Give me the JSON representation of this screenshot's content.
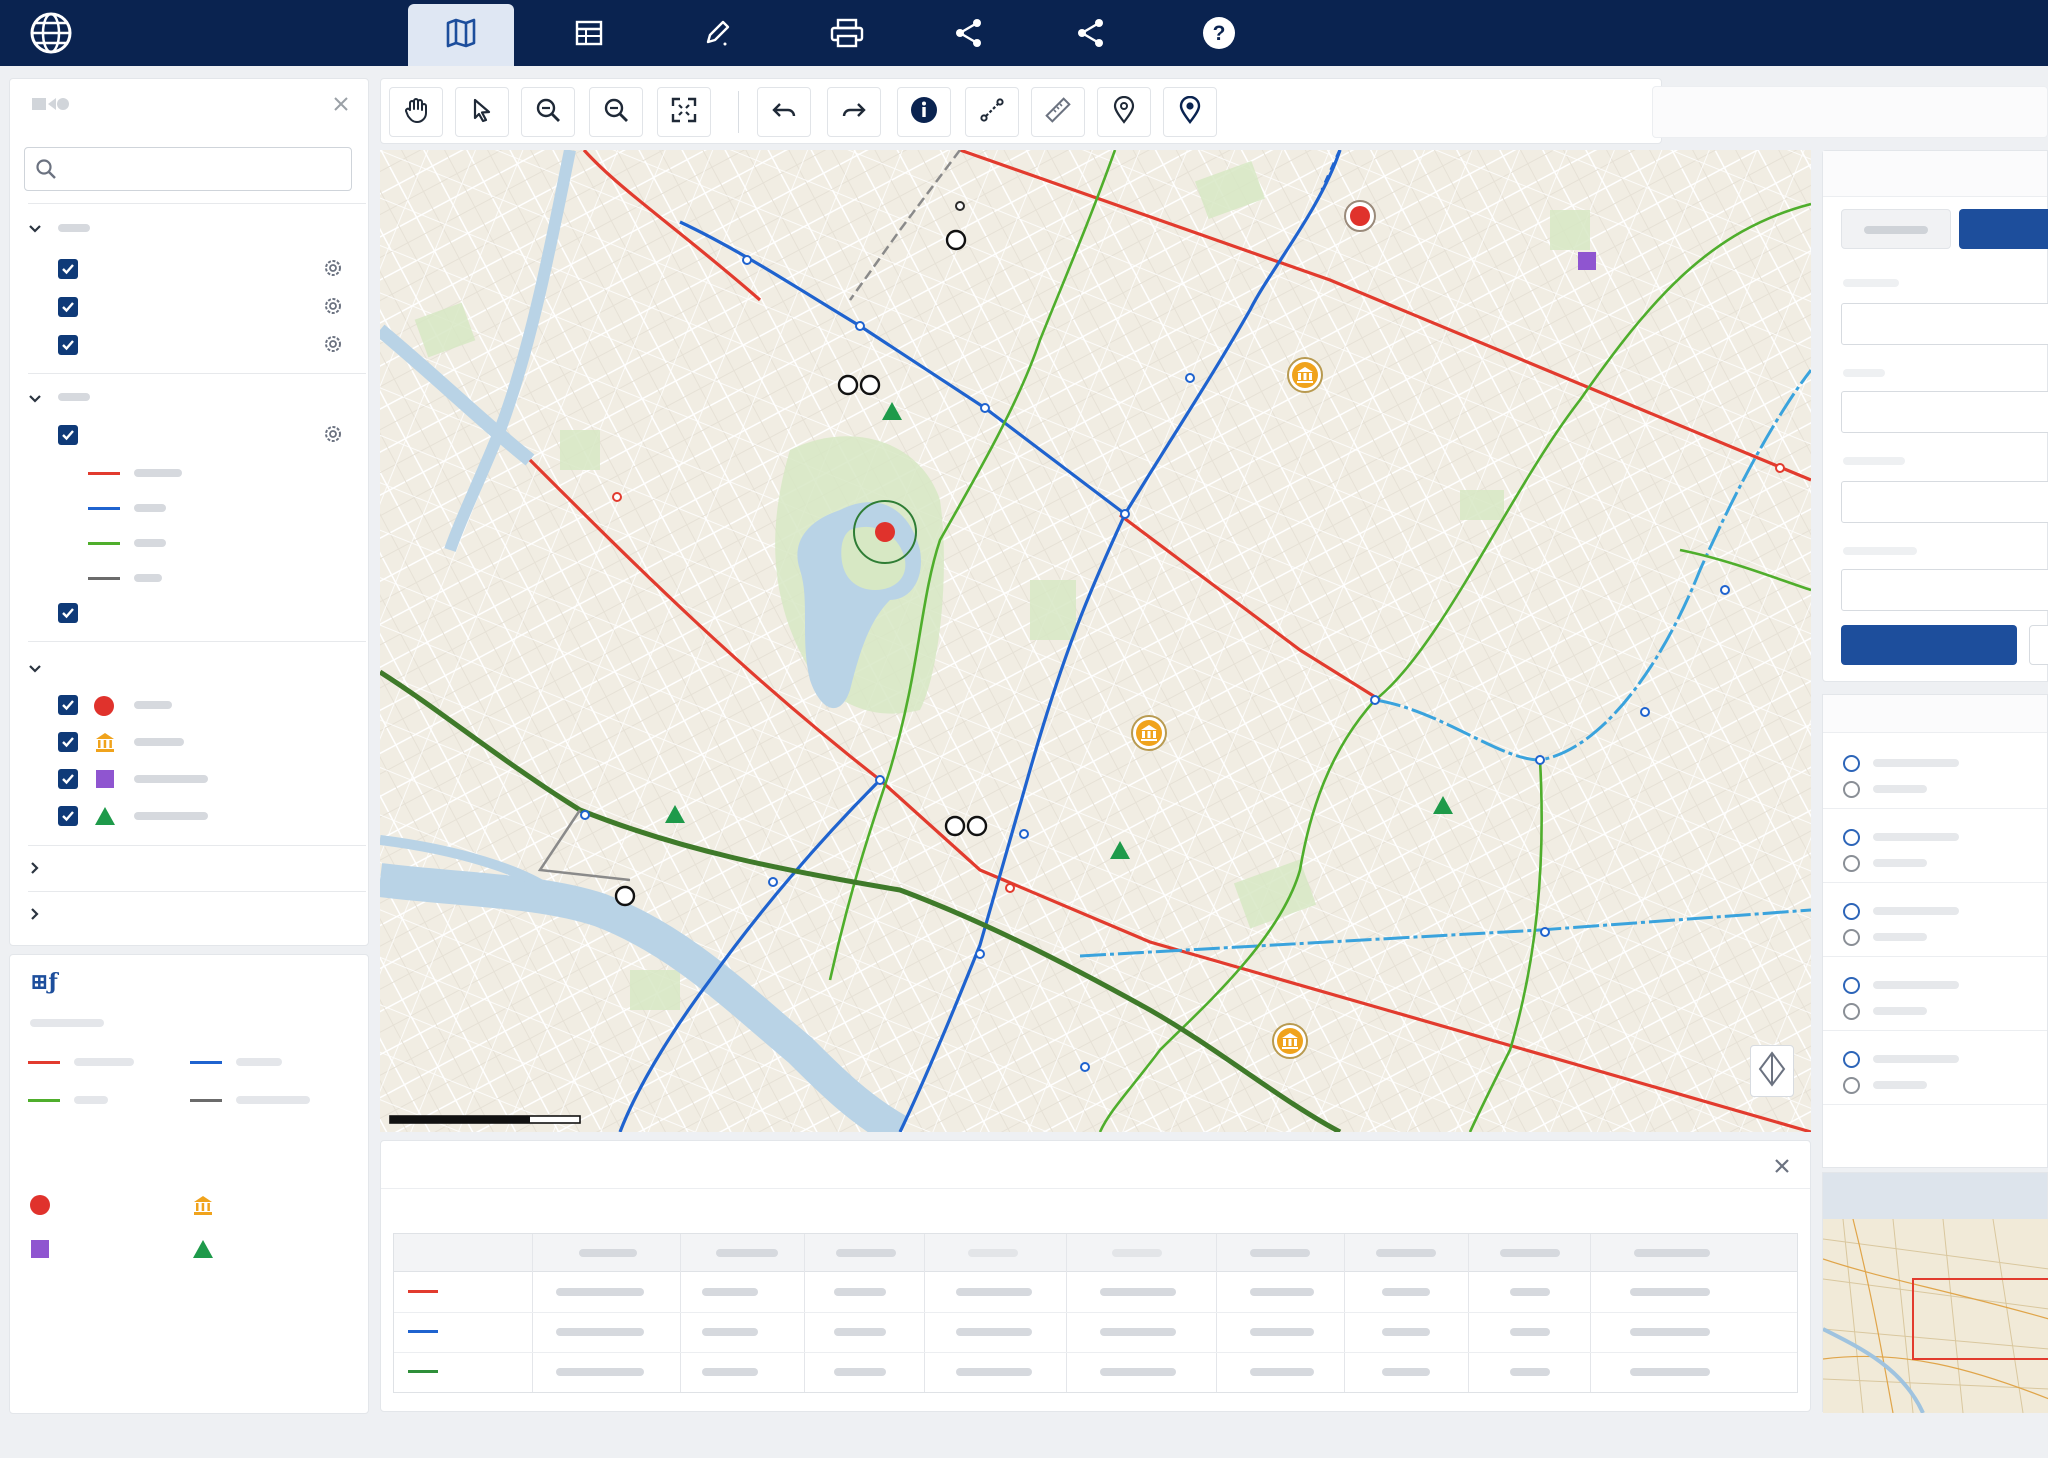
{
  "topbar": {
    "icons": [
      "globe-icon",
      "map-icon",
      "table-icon",
      "edit-icon",
      "print-icon",
      "share-icon",
      "share-icon",
      "help-icon"
    ]
  },
  "toolbar": {
    "tools": [
      "pan-icon",
      "select-icon",
      "zoom-in-icon",
      "zoom-out-icon",
      "full-extent-icon",
      "undo-icon",
      "redo-icon",
      "info-icon",
      "measure-distance-icon",
      "ruler-icon",
      "pin-icon",
      "pin-add-icon"
    ]
  },
  "colors": {
    "navy": "#0a2350",
    "accent": "#0f3a78",
    "line_red": "#e23b2e",
    "line_blue": "#1f63cf",
    "line_green": "#4fae2c",
    "line_darkgreen": "#3f7a2a",
    "line_grey": "#6b6b6b",
    "point_red": "#e0322c",
    "point_orange": "#f0a31c",
    "point_purple": "#8f55d0",
    "point_green": "#1e9a4a"
  },
  "table_panel": {
    "close_icon": "close-icon"
  },
  "legend": {
    "icon_label": "⊞ƒ"
  }
}
